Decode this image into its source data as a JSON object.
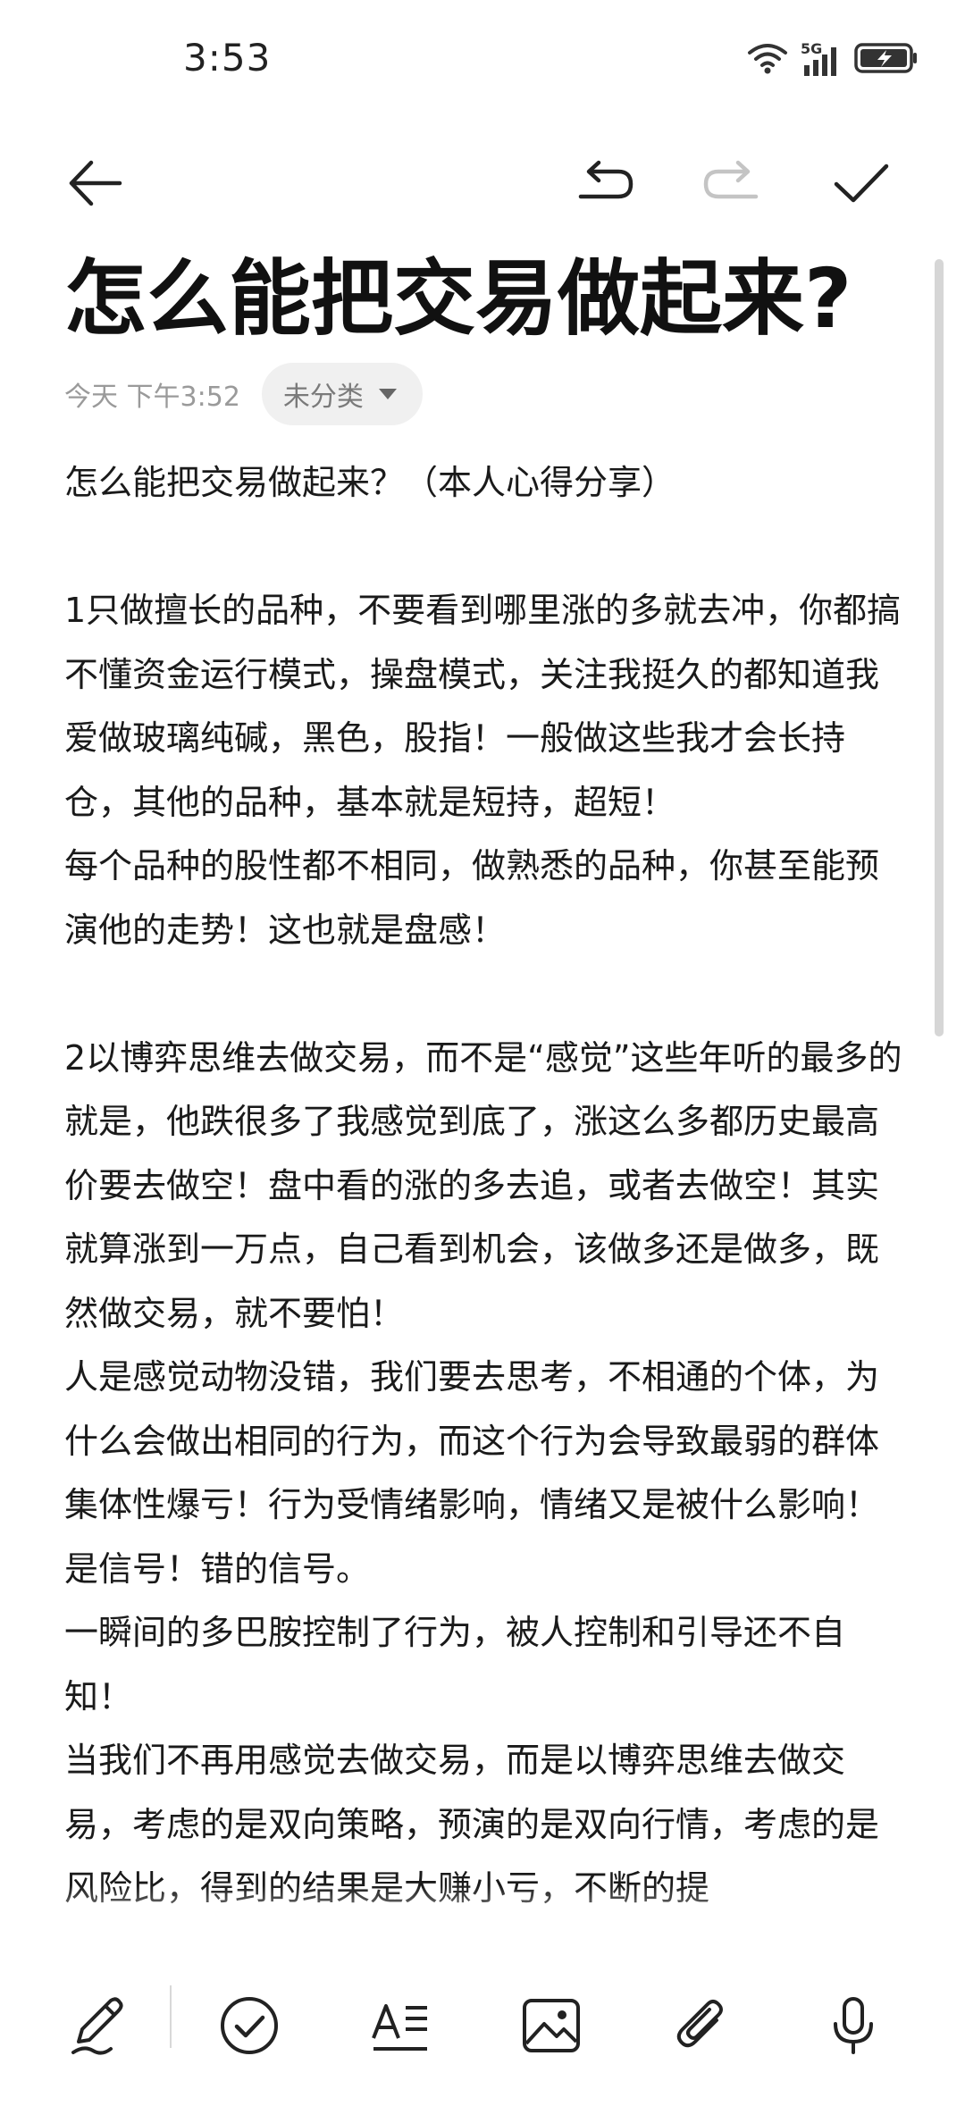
{
  "status_bar": {
    "time": "3:53",
    "network": "5G",
    "icons": [
      "wifi-icon",
      "signal-icon",
      "battery-charging-icon"
    ]
  },
  "toolbar": {
    "icons": [
      "back-arrow-icon",
      "undo-icon",
      "redo-icon",
      "check-icon"
    ],
    "redo_enabled": false
  },
  "note": {
    "title": "怎么能把交易做起来?",
    "date": "今天 下午3:52",
    "category": "未分类",
    "paragraphs": [
      "怎么能把交易做起来？（本人心得分享）",
      "",
      "1只做擅长的品种，不要看到哪里涨的多就去冲，你都搞不懂资金运行模式，操盘模式，关注我挺久的都知道我爱做玻璃纯碱，黑色，股指！一般做这些我才会长持仓，其他的品种，基本就是短持，超短！",
      "每个品种的股性都不相同，做熟悉的品种，你甚至能预演他的走势！这也就是盘感！",
      "",
      "2以博弈思维去做交易，而不是“感觉”这些年听的最多的就是，他跌很多了我感觉到底了，涨这么多都历史最高价要去做空！盘中看的涨的多去追，或者去做空！其实就算涨到一万点，自己看到机会，该做多还是做多，既然做交易，就不要怕！",
      "人是感觉动物没错，我们要去思考，不相通的个体，为什么会做出相同的行为，而这个行为会导致最弱的群体集体性爆亏！行为受情绪影响，情绪又是被什么影响！是信号！错的信号。",
      "一瞬间的多巴胺控制了行为，被人控制和引导还不自知！",
      "当我们不再用感觉去做交易，而是以博弈思维去做交易，考虑的是双向策略，预演的是双向行情，考虑的是风险比，得到的结果是大赚小亏，不断的提"
    ]
  },
  "bottom_bar": {
    "icons": [
      "pen-icon",
      "checklist-icon",
      "text-format-icon",
      "image-icon",
      "attachment-icon",
      "microphone-icon"
    ]
  }
}
